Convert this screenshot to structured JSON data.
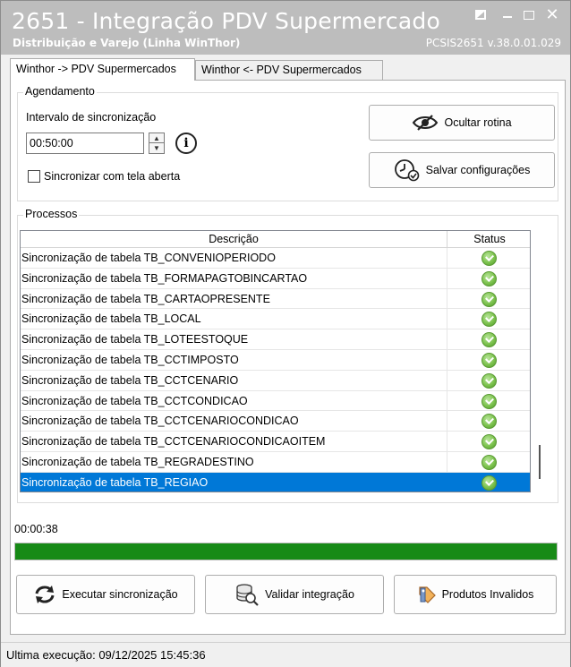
{
  "window": {
    "title": "2651 - Integração PDV Supermercado",
    "subtitle": "Distribuição e Varejo (Linha WinThor)",
    "version": "PCSIS2651  v.38.0.01.029",
    "controls": {
      "close": "✕"
    }
  },
  "tabs": [
    {
      "label": "Winthor -> PDV Supermercados",
      "active": true
    },
    {
      "label": "Winthor <- PDV Supermercados",
      "active": false
    }
  ],
  "agendamento": {
    "group_label": "Agendamento",
    "interval_label": "Intervalo de sincronização",
    "interval_value": "00:50:00",
    "info_icon": "i",
    "checkbox_label": "Sincronizar com tela aberta",
    "checkbox_checked": false,
    "ocultar_label": "Ocultar rotina",
    "salvar_label": "Salvar configurações"
  },
  "processos": {
    "group_label": "Processos",
    "columns": {
      "descricao": "Descrição",
      "status": "Status"
    },
    "rows": [
      {
        "descricao": "Sincronização de tabela TB_CONVENIOPERIODO",
        "status": "ok"
      },
      {
        "descricao": "Sincronização de tabela TB_FORMAPAGTOBINCARTAO",
        "status": "ok"
      },
      {
        "descricao": "Sincronização de tabela TB_CARTAOPRESENTE",
        "status": "ok"
      },
      {
        "descricao": "Sincronização de tabela TB_LOCAL",
        "status": "ok"
      },
      {
        "descricao": "Sincronização de tabela TB_LOTEESTOQUE",
        "status": "ok"
      },
      {
        "descricao": "Sincronização de tabela TB_CCTIMPOSTO",
        "status": "ok"
      },
      {
        "descricao": "Sincronização de tabela TB_CCTCENARIO",
        "status": "ok"
      },
      {
        "descricao": "Sincronização de tabela TB_CCTCONDICAO",
        "status": "ok"
      },
      {
        "descricao": "Sincronização de tabela TB_CCTCENARIOCONDICAO",
        "status": "ok"
      },
      {
        "descricao": "Sincronização de tabela TB_CCTCENARIOCONDICAOITEM",
        "status": "ok"
      },
      {
        "descricao": "Sincronização de tabela TB_REGRADESTINO",
        "status": "ok"
      },
      {
        "descricao": "Sincronização de tabela TB_REGIAO",
        "status": "ok",
        "selected": true
      }
    ]
  },
  "elapsed_time": "00:00:38",
  "progress_fraction": 1.0,
  "colors": {
    "progress": "#178a16",
    "selection": "#0078d7",
    "titlebar": "#bdbdbd"
  },
  "actions": {
    "executar_label": "Executar sincronização",
    "validar_label": "Validar integração",
    "invalidos_label": "Produtos Invalidos"
  },
  "statusbar": {
    "text": "Ultima execução: 09/12/2025 15:45:36"
  }
}
